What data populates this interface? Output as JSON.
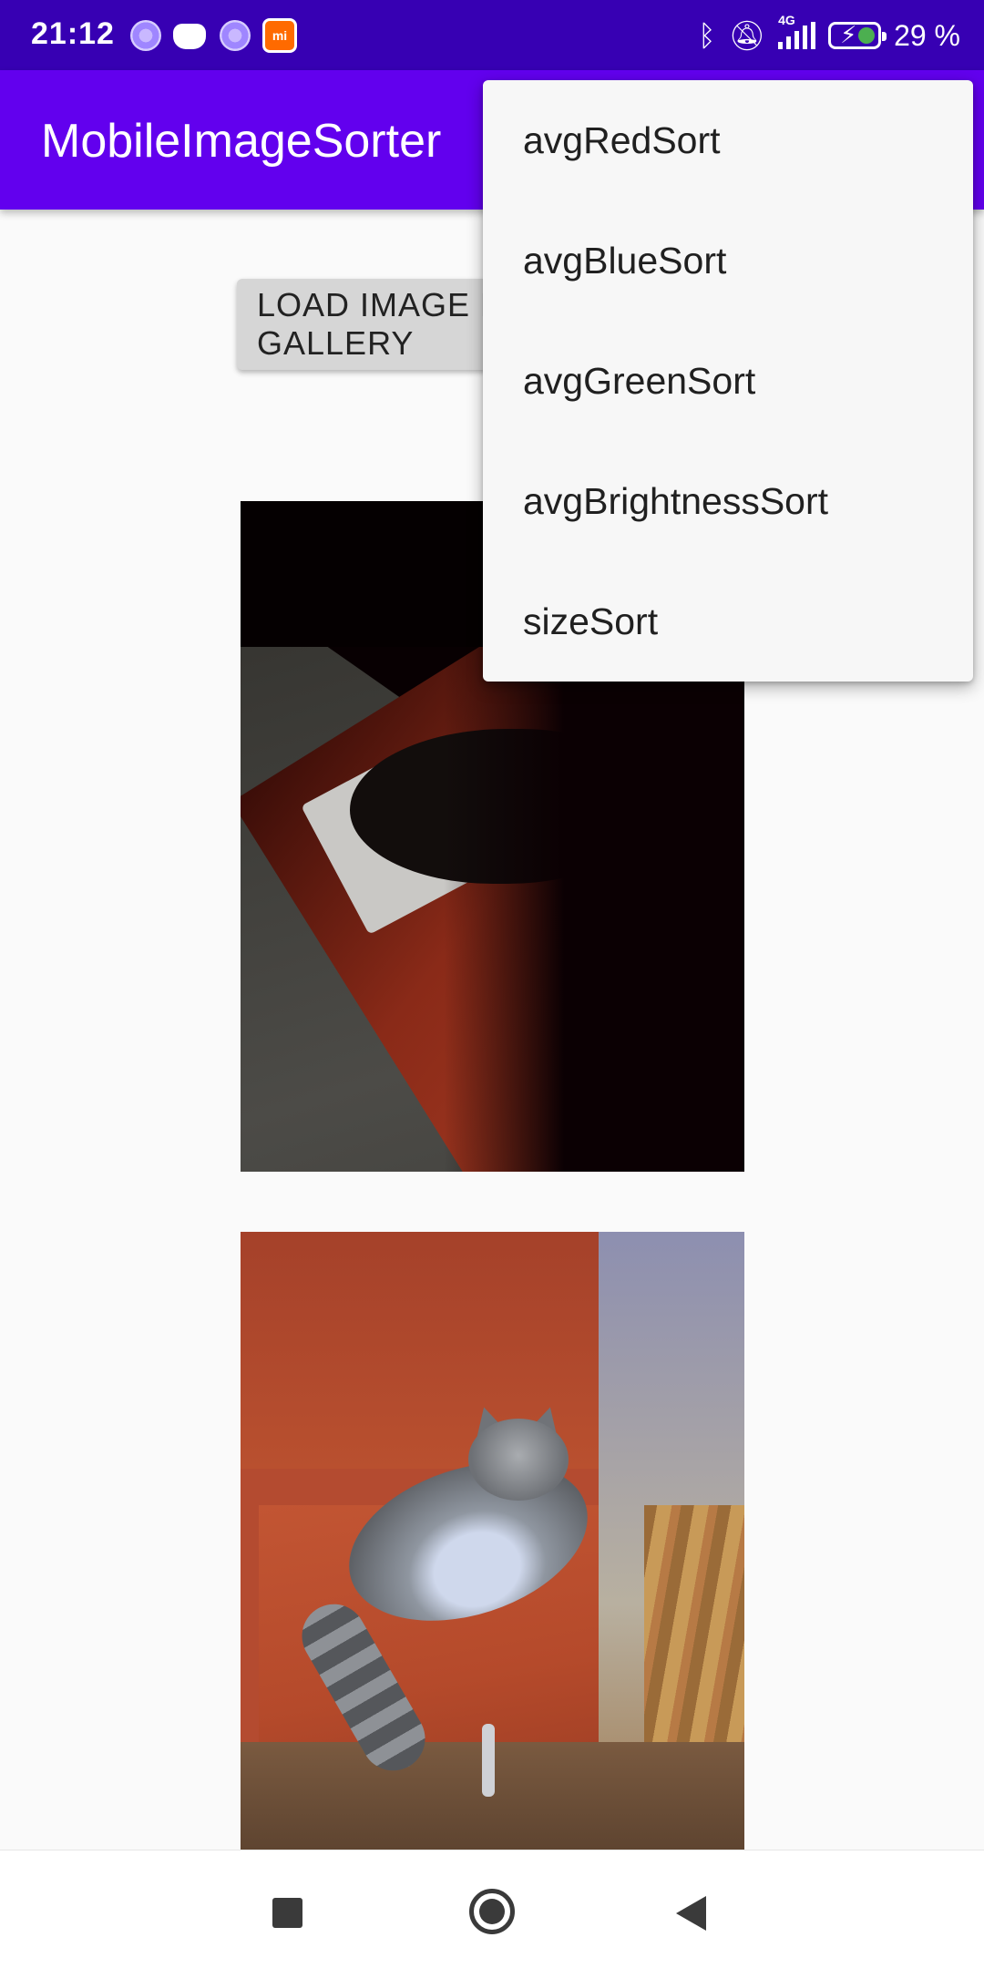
{
  "status_bar": {
    "time": "21:12",
    "network_type": "4G",
    "battery_percent": "29 %",
    "icons": [
      "spinner-app-icon",
      "gamepad-app-icon",
      "spinner-app-icon",
      "mi-app-icon",
      "bluetooth-icon",
      "bell-muted-icon",
      "signal-icon",
      "battery-charging-icon"
    ]
  },
  "app_bar": {
    "title": "MobileImageSorter",
    "background_color": "#6200ee"
  },
  "main": {
    "load_button_label": "LOAD IMAGE FROM GALLERY"
  },
  "overflow_menu": {
    "items": [
      {
        "label": "avgRedSort"
      },
      {
        "label": "avgBlueSort"
      },
      {
        "label": "avgGreenSort"
      },
      {
        "label": "avgBrightnessSort"
      },
      {
        "label": "sizeSort"
      }
    ]
  },
  "navigation_bar": {
    "icons": [
      "recents-square-icon",
      "home-circle-icon",
      "back-triangle-icon"
    ]
  }
}
